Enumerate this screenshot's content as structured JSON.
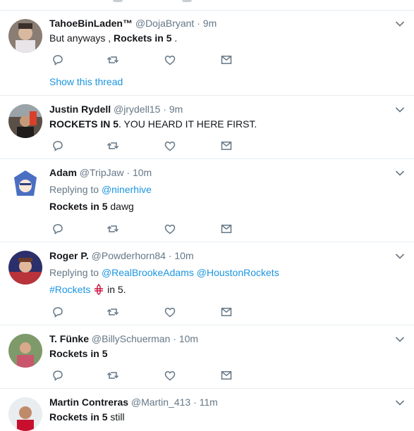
{
  "tweets": [
    {
      "name": "TahoeBinLaden™",
      "handle": "@DojaBryant",
      "time": "9m",
      "text_bold": "Rockets in 5",
      "text_pre": "But anyways , ",
      "text_post": " .",
      "show_thread": "Show this thread"
    },
    {
      "name": "Justin Rydell",
      "handle": "@jrydell15",
      "time": "9m",
      "text_bold": "ROCKETS IN 5",
      "text_post": ". YOU HEARD IT HERE FIRST."
    },
    {
      "name": "Adam",
      "handle": "@TripJaw",
      "time": "10m",
      "replying_label": "Replying to",
      "replying_to": "@ninerhive",
      "text_bold": "Rockets in 5",
      "text_post": " dawg"
    },
    {
      "name": "Roger P.",
      "handle": "@Powderhorn84",
      "time": "10m",
      "replying_label": "Replying to",
      "replying_to_1": "@RealBrookeAdams",
      "replying_to_2": "@HoustonRockets",
      "hashtag": "#Rockets",
      "text_post": " in 5."
    },
    {
      "name": "T. Fünke",
      "handle": "@BillySchuerman",
      "time": "10m",
      "text_bold": "Rockets in 5"
    },
    {
      "name": "Martin Contreras",
      "handle": "@Martin_413",
      "time": "11m",
      "text_bold": "Rockets in 5",
      "text_post": " still"
    }
  ],
  "separator": "·",
  "icons": [
    "reply-icon",
    "retweet-icon",
    "like-icon",
    "message-icon",
    "chevron-down-icon"
  ],
  "colors": {
    "link": "#1b95e0",
    "secondary": "#657786",
    "divider": "#e6ecf0",
    "icon": "#657786"
  }
}
